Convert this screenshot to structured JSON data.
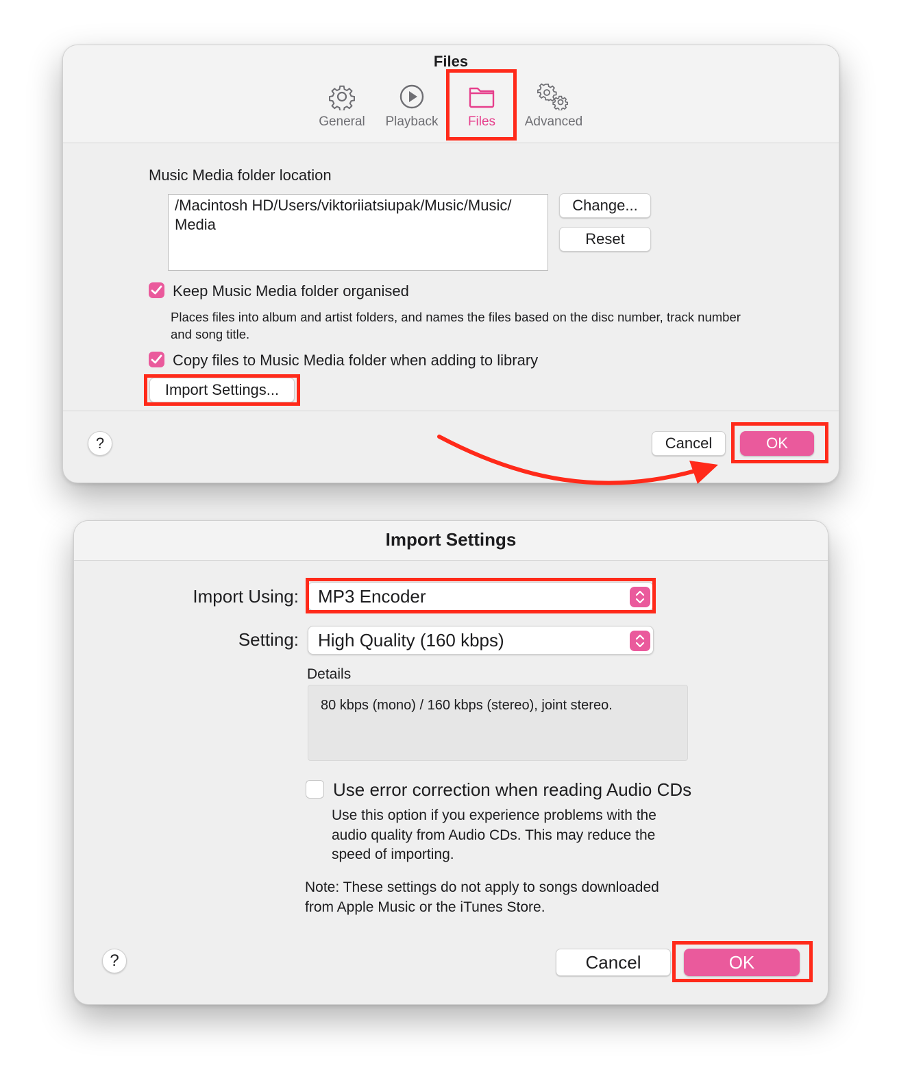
{
  "preferences": {
    "title": "Files",
    "tabs": [
      {
        "label": "General",
        "icon": "gear-icon"
      },
      {
        "label": "Playback",
        "icon": "play-circle-icon"
      },
      {
        "label": "Files",
        "icon": "folder-icon",
        "selected": true
      },
      {
        "label": "Advanced",
        "icon": "gears-icon"
      }
    ],
    "folder_label": "Music Media folder location",
    "folder_path_line1": "/Macintosh HD/Users/viktoriiatsiupak/Music/Music/",
    "folder_path_line2": "Media",
    "change_button": "Change...",
    "reset_button": "Reset",
    "keep_organised": {
      "label": "Keep Music Media folder organised",
      "checked": true
    },
    "keep_organised_desc_line1": "Places files into album and artist folders, and names the files based on the disc number, track number",
    "keep_organised_desc_line2": "and song title.",
    "copy_files": {
      "label": "Copy files to Music Media folder when adding to library",
      "checked": true
    },
    "import_settings_button": "Import Settings...",
    "help": "?",
    "cancel_button": "Cancel",
    "ok_button": "OK"
  },
  "import_settings": {
    "title": "Import Settings",
    "import_using_label": "Import Using:",
    "import_using_value": "MP3 Encoder",
    "setting_label": "Setting:",
    "setting_value": "High Quality (160 kbps)",
    "details_label": "Details",
    "details_text": "80 kbps (mono) / 160 kbps (stereo), joint stereo.",
    "error_correction": {
      "label": "Use error correction when reading Audio CDs",
      "checked": false
    },
    "error_desc_line1": "Use this option if you experience problems with the",
    "error_desc_line2": "audio quality from Audio CDs. This may reduce the",
    "error_desc_line3": "speed of importing.",
    "note_line1": "Note: These settings do not apply to songs downloaded",
    "note_line2": "from Apple Music or the iTunes Store.",
    "help": "?",
    "cancel_button": "Cancel",
    "ok_button": "OK"
  },
  "colors": {
    "accent": "#ea5a9c",
    "highlight": "#ff2a1a"
  }
}
